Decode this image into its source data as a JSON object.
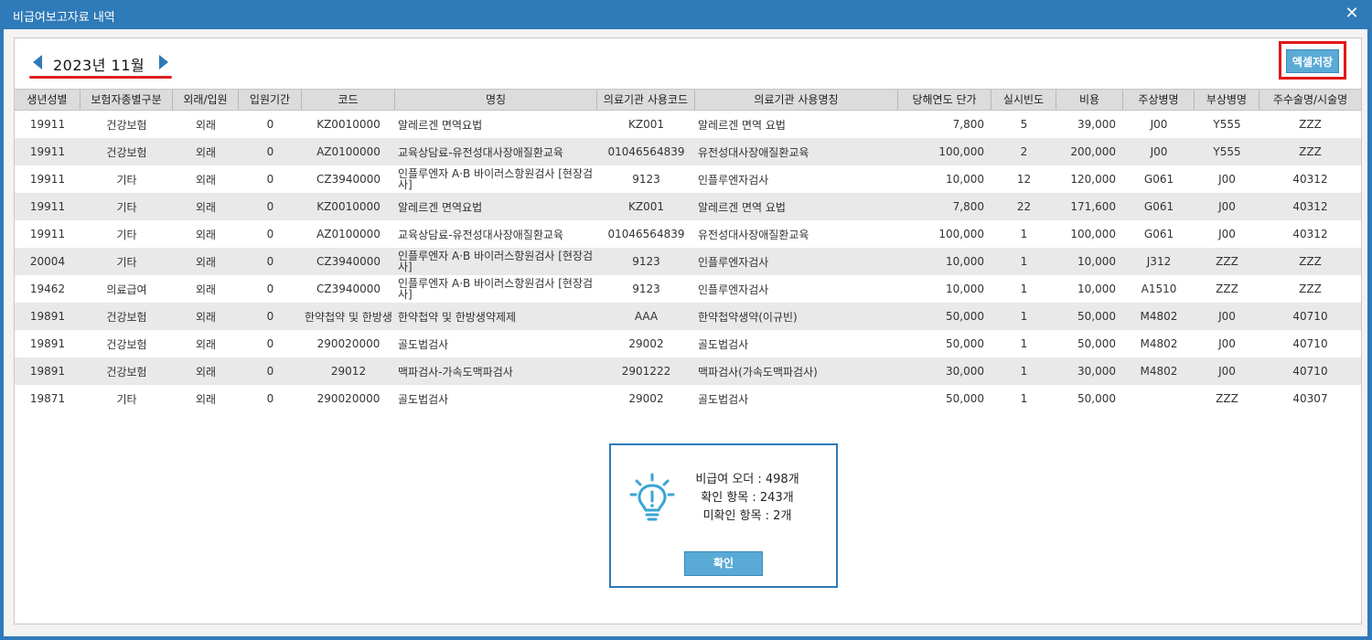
{
  "window": {
    "title": "비급여보고자료 내역",
    "close_glyph": "✕"
  },
  "month_nav": {
    "label": "2023년 11월"
  },
  "toolbar": {
    "excel_label": "엑셀저장"
  },
  "table": {
    "headers": [
      "생년성별",
      "보험자종별구분",
      "외래/입원",
      "입원기간",
      "코드",
      "명칭",
      "의료기관 사용코드",
      "의료기관 사용명칭",
      "당해연도 단가",
      "실시빈도",
      "비용",
      "주상병명",
      "부상병명",
      "주수술명/시술명"
    ],
    "rows": [
      [
        "19911",
        "건강보험",
        "외래",
        "0",
        "KZ0010000",
        "알레르겐 면역요법",
        "KZ001",
        "알레르겐 면역 요법",
        "7,800",
        "5",
        "39,000",
        "J00",
        "Y555",
        "ZZZ"
      ],
      [
        "19911",
        "건강보험",
        "외래",
        "0",
        "AZ0100000",
        "교육상담료-유전성대사장애질환교육",
        "01046564839",
        "유전성대사장애질환교육",
        "100,000",
        "2",
        "200,000",
        "J00",
        "Y555",
        "ZZZ"
      ],
      [
        "19911",
        "기타",
        "외래",
        "0",
        "CZ3940000",
        "인플루엔자 A·B 바이러스항원검사 [현장검사]",
        "9123",
        "인플루엔자검사",
        "10,000",
        "12",
        "120,000",
        "G061",
        "J00",
        "40312"
      ],
      [
        "19911",
        "기타",
        "외래",
        "0",
        "KZ0010000",
        "알레르겐 면역요법",
        "KZ001",
        "알레르겐 면역 요법",
        "7,800",
        "22",
        "171,600",
        "G061",
        "J00",
        "40312"
      ],
      [
        "19911",
        "기타",
        "외래",
        "0",
        "AZ0100000",
        "교육상담료-유전성대사장애질환교육",
        "01046564839",
        "유전성대사장애질환교육",
        "100,000",
        "1",
        "100,000",
        "G061",
        "J00",
        "40312"
      ],
      [
        "20004",
        "기타",
        "외래",
        "0",
        "CZ3940000",
        "인플루엔자 A·B 바이러스항원검사 [현장검사]",
        "9123",
        "인플루엔자검사",
        "10,000",
        "1",
        "10,000",
        "J312",
        "ZZZ",
        "ZZZ"
      ],
      [
        "19462",
        "의료급여",
        "외래",
        "0",
        "CZ3940000",
        "인플루엔자 A·B 바이러스항원검사 [현장검사]",
        "9123",
        "인플루엔자검사",
        "10,000",
        "1",
        "10,000",
        "A1510",
        "ZZZ",
        "ZZZ"
      ],
      [
        "19891",
        "건강보험",
        "외래",
        "0",
        "한약첩약 및 한방생",
        "한약첩약 및 한방생약제제",
        "AAA",
        "한약첩약생약(이규빈)",
        "50,000",
        "1",
        "50,000",
        "M4802",
        "J00",
        "40710"
      ],
      [
        "19891",
        "건강보험",
        "외래",
        "0",
        "290020000",
        "골도법검사",
        "29002",
        "골도법검사",
        "50,000",
        "1",
        "50,000",
        "M4802",
        "J00",
        "40710"
      ],
      [
        "19891",
        "건강보험",
        "외래",
        "0",
        "29012",
        "맥파검사-가속도맥파검사",
        "2901222",
        "맥파검사(가속도맥파검사)",
        "30,000",
        "1",
        "30,000",
        "M4802",
        "J00",
        "40710"
      ],
      [
        "19871",
        "기타",
        "외래",
        "0",
        "290020000",
        "골도법검사",
        "29002",
        "골도법검사",
        "50,000",
        "1",
        "50,000",
        "",
        "ZZZ",
        "40307"
      ]
    ]
  },
  "dialog": {
    "icon": "lightbulb-icon",
    "line1": "비급여 오더 : 498개",
    "line2": "확인 항목 : 243개",
    "line3": "미확인 항목 : 2개",
    "ok_label": "확인"
  }
}
